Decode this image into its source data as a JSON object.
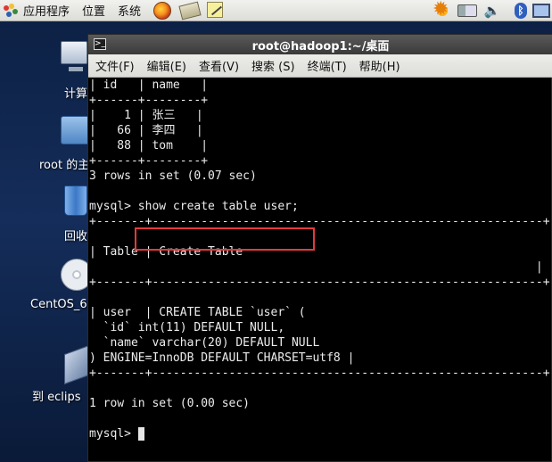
{
  "panel": {
    "menu": [
      "应用程序",
      "位置",
      "系统"
    ],
    "launchers": [
      "firefox-icon",
      "mail-icon",
      "note-icon"
    ],
    "tray": [
      "weather-icon",
      "network-icon",
      "volume-icon",
      "bluetooth-icon",
      "display-icon"
    ]
  },
  "desktop_icons": [
    {
      "label": "计算",
      "icon": "computer-icon"
    },
    {
      "label": "root 的主",
      "icon": "home-folder-icon"
    },
    {
      "label": "回收",
      "icon": "trash-icon"
    },
    {
      "label": "CentOS_6",
      "icon": "disc-icon"
    },
    {
      "label": "到 eclips",
      "icon": "eclipse-link-icon"
    }
  ],
  "terminal": {
    "title": "root@hadoop1:~/桌面",
    "menu": [
      "文件(F)",
      "编辑(E)",
      "查看(V)",
      "搜索 (S)",
      "终端(T)",
      "帮助(H)"
    ],
    "lines": [
      "| id   | name   |",
      "+------+--------+",
      "|    1 | 张三   |",
      "|   66 | 李四   |",
      "|   88 | tom    |",
      "+------+--------+",
      "3 rows in set (0.07 sec)",
      "",
      "mysql> show create table user;",
      "+-------+--------------------------------------------------------+",
      "",
      "| Table | Create Table",
      "                                                                |",
      "+-------+--------------------------------------------------------+",
      "",
      "| user  | CREATE TABLE `user` (",
      "  `id` int(11) DEFAULT NULL,",
      "  `name` varchar(20) DEFAULT NULL",
      ") ENGINE=InnoDB DEFAULT CHARSET=utf8 |",
      "+-------+--------------------------------------------------------+",
      "",
      "1 row in set (0.00 sec)",
      "",
      "mysql> "
    ],
    "highlight_color": "#e53a3a"
  }
}
